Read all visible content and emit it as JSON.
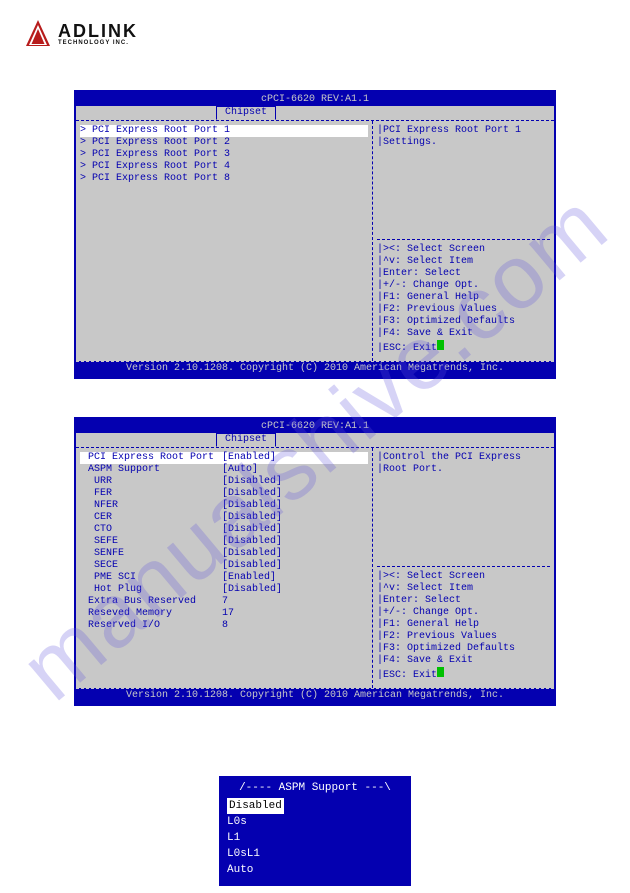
{
  "watermark": "manualshive.com",
  "logo": {
    "name": "ADLINK",
    "sub": "TECHNOLOGY INC."
  },
  "footer": "Version 2.10.1208. Copyright (C) 2010 American Megatrends, Inc.",
  "keys": [
    "><: Select Screen",
    "^v: Select Item",
    "Enter: Select",
    "+/-: Change Opt.",
    "F1: General Help",
    "F2: Previous Values",
    "F3: Optimized Defaults",
    "F4: Save & Exit",
    "ESC: Exit"
  ],
  "bios1": {
    "title": "cPCI-6620 REV:A1.1",
    "tab": "Chipset",
    "menu": [
      "> PCI Express Root Port 1",
      "> PCI Express Root Port 2",
      "> PCI Express Root Port 3",
      "> PCI Express Root Port 4",
      "> PCI Express Root Port 8"
    ],
    "help": [
      "PCI Express Root Port 1",
      "Settings."
    ]
  },
  "bios2": {
    "title": "cPCI-6620 REV:A1.1",
    "tab": "Chipset",
    "rows": [
      {
        "k": " PCI Express Root Port",
        "v": "[Enabled]"
      },
      {
        "k": " ASPM Support",
        "v": "[Auto]"
      },
      {
        "k": "  URR",
        "v": "[Disabled]"
      },
      {
        "k": "  FER",
        "v": "[Disabled]"
      },
      {
        "k": "  NFER",
        "v": "[Disabled]"
      },
      {
        "k": "  CER",
        "v": "[Disabled]"
      },
      {
        "k": "  CTO",
        "v": "[Disabled]"
      },
      {
        "k": "  SEFE",
        "v": "[Disabled]"
      },
      {
        "k": "  SENFE",
        "v": "[Disabled]"
      },
      {
        "k": "  SECE",
        "v": "[Disabled]"
      },
      {
        "k": "  PME SCI",
        "v": "[Enabled]"
      },
      {
        "k": "  Hot Plug",
        "v": "[Disabled]"
      },
      {
        "k": " Extra Bus Reserved",
        "v": "7"
      },
      {
        "k": " Reseved Memory",
        "v": "17"
      },
      {
        "k": " Reserved I/O",
        "v": "8"
      }
    ],
    "help": [
      "Control the PCI Express",
      "Root Port."
    ]
  },
  "popup": {
    "title": "/---- ASPM Support ---\\",
    "items": [
      "Disabled",
      "L0s",
      "L1",
      "L0sL1",
      "Auto"
    ]
  }
}
